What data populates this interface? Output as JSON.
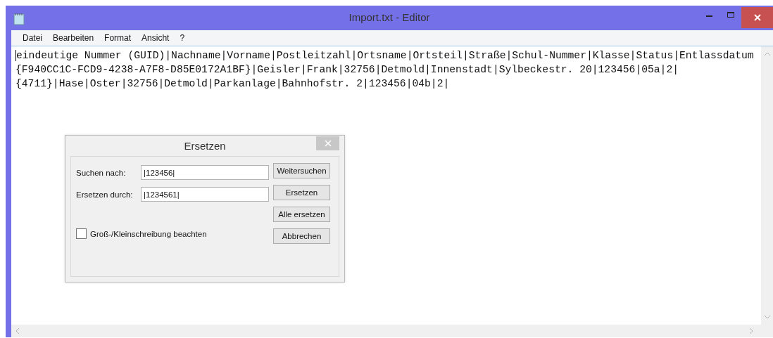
{
  "window": {
    "title": "Import.txt - Editor"
  },
  "menu": [
    "Datei",
    "Bearbeiten",
    "Format",
    "Ansicht",
    "?"
  ],
  "editor": {
    "lines": [
      "eindeutige Nummer (GUID)|Nachname|Vorname|Postleitzahl|Ortsname|Ortsteil|Straße|Schul-Nummer|Klasse|Status|Entlassdatum",
      "{F940CC1C-FCD9-4238-A7F8-D85E0172A1BF}|Geisler|Frank|32756|Detmold|Innenstadt|Sylbeckestr. 20|123456|05a|2|",
      "{4711}|Hase|Oster|32756|Detmold|Parkanlage|Bahnhofstr. 2|123456|04b|2|"
    ]
  },
  "dialog": {
    "title": "Ersetzen",
    "fields": [
      {
        "label": "Suchen nach:",
        "value": "|123456|"
      },
      {
        "label": "Ersetzen durch:",
        "value": "|1234561|"
      }
    ],
    "checkbox": {
      "label": "Groß-/Kleinschreibung beachten",
      "checked": false
    },
    "buttons": [
      "Weitersuchen",
      "Ersetzen",
      "Alle ersetzen",
      "Abbrechen"
    ]
  }
}
